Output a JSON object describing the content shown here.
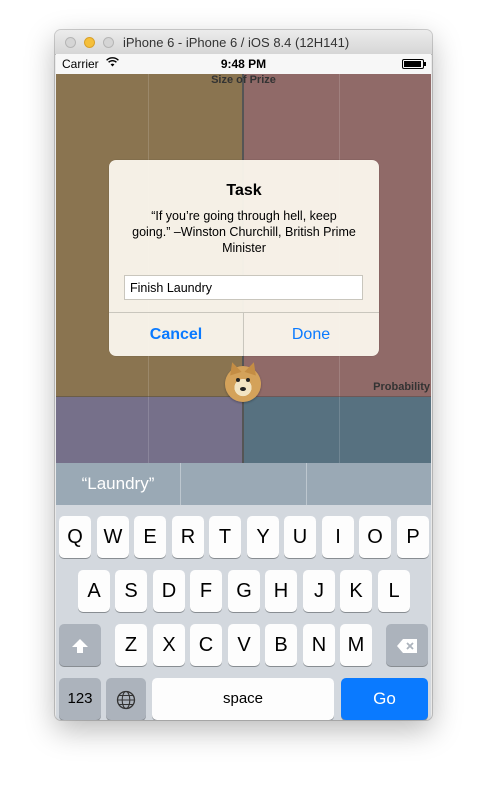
{
  "window": {
    "title": "iPhone 6 - iPhone 6 / iOS 8.4 (12H141)"
  },
  "status_bar": {
    "carrier": "Carrier",
    "wifi_icon": "wifi-icon",
    "time": "9:48 PM",
    "battery_icon": "battery-icon"
  },
  "chart": {
    "top_label": "Size of Prize",
    "right_label": "Probability",
    "quadrant_colors": {
      "top_left": "#8a7450",
      "top_right": "#906a68",
      "bottom_left": "#76708a",
      "bottom_right": "#577180"
    },
    "marker_icon": "doge-icon"
  },
  "alert": {
    "title": "Task",
    "message": "“If you’re going through hell, keep going.”  –Winston Churchill, British Prime Minister",
    "input_value": "Finish Laundry",
    "cancel_label": "Cancel",
    "done_label": "Done"
  },
  "predictive": {
    "items": [
      "“Laundry”",
      "",
      ""
    ]
  },
  "keyboard": {
    "row1": [
      "Q",
      "W",
      "E",
      "R",
      "T",
      "Y",
      "U",
      "I",
      "O",
      "P"
    ],
    "row2": [
      "A",
      "S",
      "D",
      "F",
      "G",
      "H",
      "J",
      "K",
      "L"
    ],
    "row3": [
      "Z",
      "X",
      "C",
      "V",
      "B",
      "N",
      "M"
    ],
    "shift_icon": "shift-icon",
    "delete_icon": "delete-icon",
    "numbers_label": "123",
    "globe_icon": "globe-icon",
    "space_label": "space",
    "go_label": "Go",
    "accent_color": "#0a7aff"
  }
}
